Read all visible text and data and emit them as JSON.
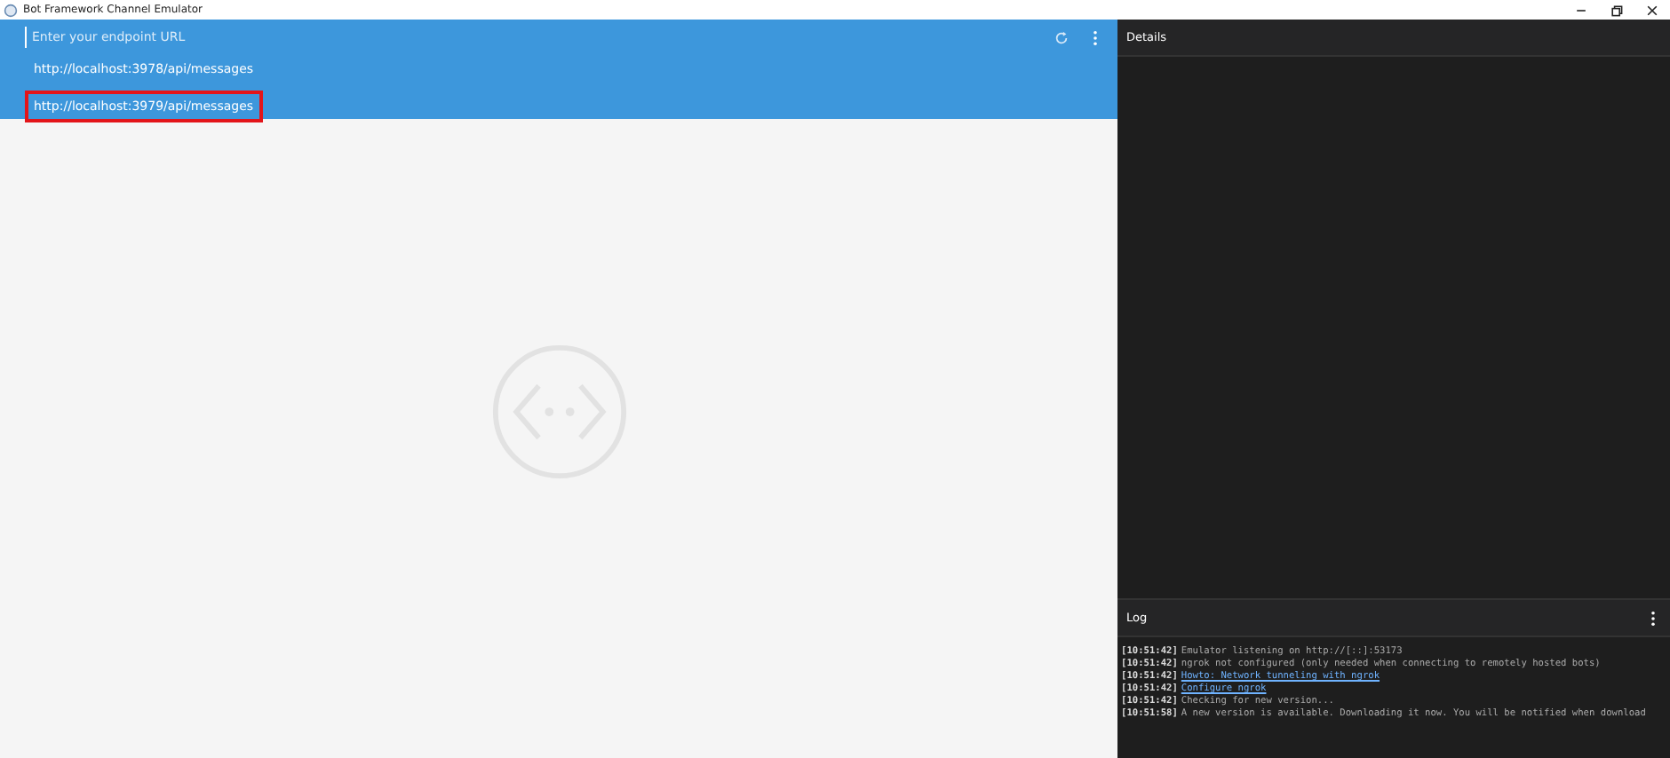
{
  "window": {
    "title": "Bot Framework Channel Emulator"
  },
  "endpoint": {
    "placeholder": "Enter your endpoint URL",
    "suggestions": [
      {
        "url": "http://localhost:3978/api/messages",
        "selected": false
      },
      {
        "url": "http://localhost:3979/api/messages",
        "selected": true
      }
    ]
  },
  "details": {
    "title": "Details"
  },
  "log": {
    "title": "Log",
    "entries": [
      {
        "time": "[10:51:42]",
        "text": "Emulator listening on http://[::]:53173",
        "kind": "text"
      },
      {
        "time": "[10:51:42]",
        "text": "ngrok not configured (only needed when connecting to remotely hosted bots)",
        "kind": "text"
      },
      {
        "time": "[10:51:42]",
        "text": "Howto: Network tunneling with ngrok",
        "kind": "link"
      },
      {
        "time": "[10:51:42]",
        "text": "Configure ngrok",
        "kind": "link"
      },
      {
        "time": "[10:51:42]",
        "text": "Checking for new version...",
        "kind": "text"
      },
      {
        "time": "[10:51:58]",
        "text": "A new version is available. Downloading it now. You will be notified when download",
        "kind": "text"
      }
    ]
  }
}
